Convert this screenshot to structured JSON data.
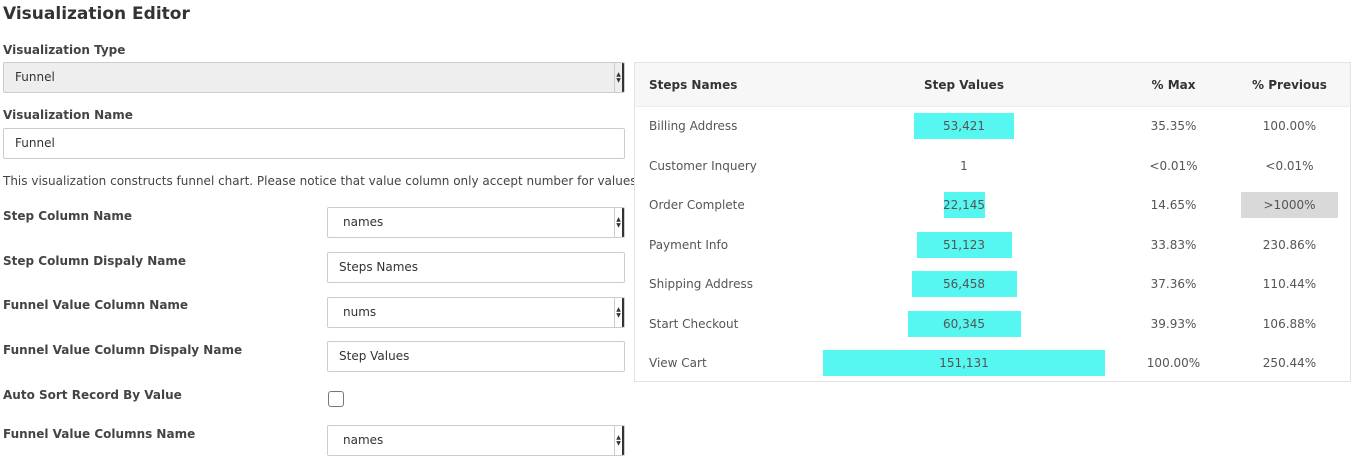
{
  "editor": {
    "title": "Visualization Editor",
    "visualization_type_label": "Visualization Type",
    "visualization_type_value": "Funnel",
    "visualization_name_label": "Visualization Name",
    "visualization_name_value": "Funnel",
    "description": "This visualization constructs funnel chart. Please notice that value column only accept number for values.",
    "step_column_name_label": "Step Column Name",
    "step_column_name_value": "names",
    "step_column_display_label": "Step Column Dispaly Name",
    "step_column_display_value": "Steps Names",
    "funnel_value_column_label": "Funnel Value Column Name",
    "funnel_value_column_value": "nums",
    "funnel_value_display_label": "Funnel Value Column Dispaly Name",
    "funnel_value_display_value": "Step Values",
    "auto_sort_label": "Auto Sort Record By Value",
    "auto_sort_checked": false,
    "funnel_value_columns_label": "Funnel Value Columns Name",
    "funnel_value_columns_value": "names"
  },
  "preview": {
    "headers": {
      "step_name": "Steps Names",
      "step_value": "Step Values",
      "pct_max": "% Max",
      "pct_prev": "% Previous"
    },
    "bar_color": "#56f7f0",
    "highlight_color": "#d9d9d9",
    "rows": [
      {
        "name": "Billing Address",
        "value": 53421,
        "value_label": "53,421",
        "pct_max": "35.35%",
        "pct_prev": "100.00%",
        "prev_highlight": false
      },
      {
        "name": "Customer Inquery",
        "value": 1,
        "value_label": "1",
        "pct_max": "<0.01%",
        "pct_prev": "<0.01%",
        "prev_highlight": false
      },
      {
        "name": "Order Complete",
        "value": 22145,
        "value_label": "22,145",
        "pct_max": "14.65%",
        "pct_prev": ">1000%",
        "prev_highlight": true
      },
      {
        "name": "Payment Info",
        "value": 51123,
        "value_label": "51,123",
        "pct_max": "33.83%",
        "pct_prev": "230.86%",
        "prev_highlight": false
      },
      {
        "name": "Shipping Address",
        "value": 56458,
        "value_label": "56,458",
        "pct_max": "37.36%",
        "pct_prev": "110.44%",
        "prev_highlight": false
      },
      {
        "name": "Start Checkout",
        "value": 60345,
        "value_label": "60,345",
        "pct_max": "39.93%",
        "pct_prev": "106.88%",
        "prev_highlight": false
      },
      {
        "name": "View Cart",
        "value": 151131,
        "value_label": "151,131",
        "pct_max": "100.00%",
        "pct_prev": "250.44%",
        "prev_highlight": false
      }
    ]
  }
}
